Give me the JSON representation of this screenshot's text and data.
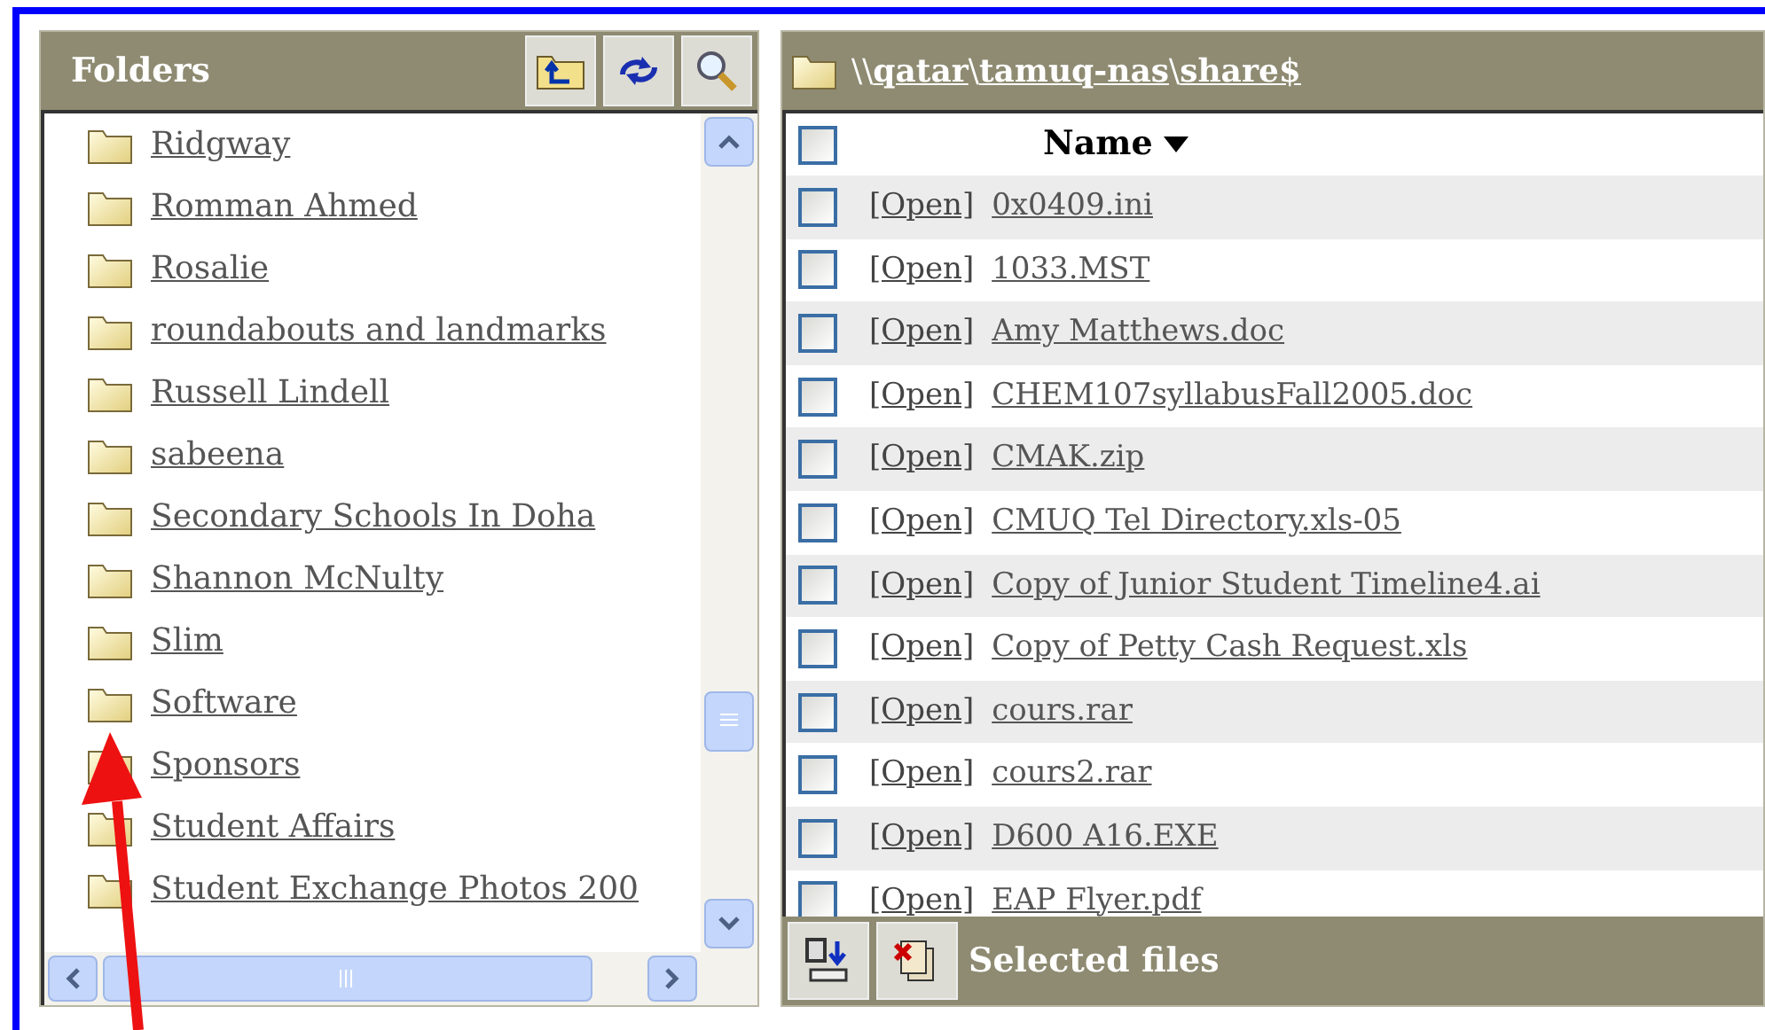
{
  "folders_panel": {
    "title": "Folders",
    "folders": [
      {
        "name": "Ridgway"
      },
      {
        "name": "Romman  Ahmed"
      },
      {
        "name": "Rosalie"
      },
      {
        "name": "roundabouts and landmarks"
      },
      {
        "name": "Russell Lindell"
      },
      {
        "name": "sabeena"
      },
      {
        "name": "Secondary Schools In Doha"
      },
      {
        "name": "Shannon McNulty"
      },
      {
        "name": "Slim"
      },
      {
        "name": "Software"
      },
      {
        "name": "Sponsors"
      },
      {
        "name": "Student Affairs"
      },
      {
        "name": "Student Exchange Photos 200"
      }
    ]
  },
  "files_panel": {
    "path": [
      "qatar",
      "tamuq-nas",
      "share$"
    ],
    "path_prefix": "\\\\",
    "separator": "\\",
    "header_checked": false,
    "column": "Name",
    "files": [
      {
        "open": "[Open]",
        "name": "0x0409.ini",
        "checked": false
      },
      {
        "open": "[Open]",
        "name": "1033.MST",
        "checked": false
      },
      {
        "open": "[Open]",
        "name": "Amy Matthews.doc",
        "checked": false
      },
      {
        "open": "[Open]",
        "name": "CHEM107syllabusFall2005.doc",
        "checked": false
      },
      {
        "open": "[Open]",
        "name": "CMAK.zip",
        "checked": false
      },
      {
        "open": "[Open]",
        "name": "CMUQ Tel Directory.xls-05",
        "checked": false
      },
      {
        "open": "[Open]",
        "name": "Copy of Junior  Student  Timeline4.ai",
        "checked": false
      },
      {
        "open": "[Open]",
        "name": "Copy of Petty Cash Request.xls",
        "checked": false
      },
      {
        "open": "[Open]",
        "name": "cours.rar",
        "checked": false
      },
      {
        "open": "[Open]",
        "name": "cours2.rar",
        "checked": false
      },
      {
        "open": "[Open]",
        "name": "D600  A16.EXE",
        "checked": false
      },
      {
        "open": "[Open]",
        "name": "EAP Flyer.pdf",
        "checked": false
      }
    ],
    "footer": "Selected files"
  }
}
